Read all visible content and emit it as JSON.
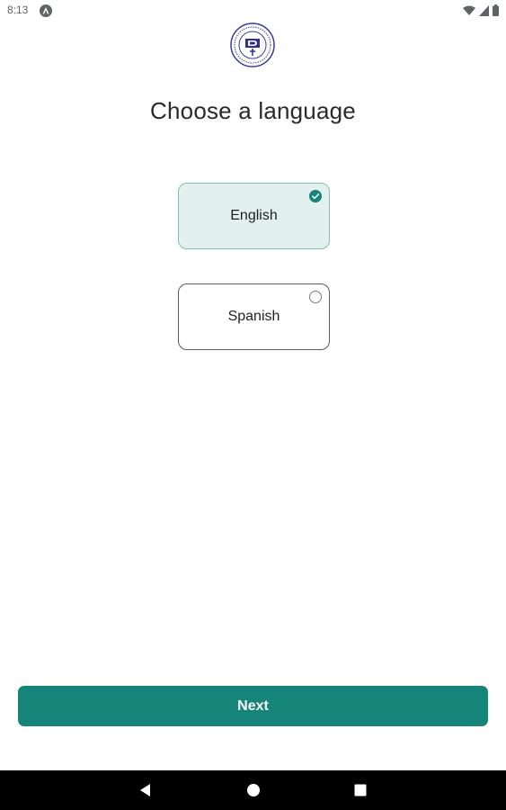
{
  "status_bar": {
    "time": "8:13",
    "icons": [
      "app-notification-icon",
      "wifi-icon",
      "signal-icon",
      "battery-icon"
    ]
  },
  "logo": {
    "icon": "organization-seal-logo"
  },
  "screen": {
    "title": "Choose a language"
  },
  "languages": [
    {
      "label": "English",
      "selected": true
    },
    {
      "label": "Spanish",
      "selected": false
    }
  ],
  "actions": {
    "next_label": "Next"
  },
  "colors": {
    "accent": "#15857a",
    "selected_bg": "#e2f1ee",
    "selected_border": "#86bfb3",
    "nav_bar": "#000000"
  },
  "nav_bar": {
    "icons": [
      "back-icon",
      "home-icon",
      "recents-icon"
    ]
  }
}
